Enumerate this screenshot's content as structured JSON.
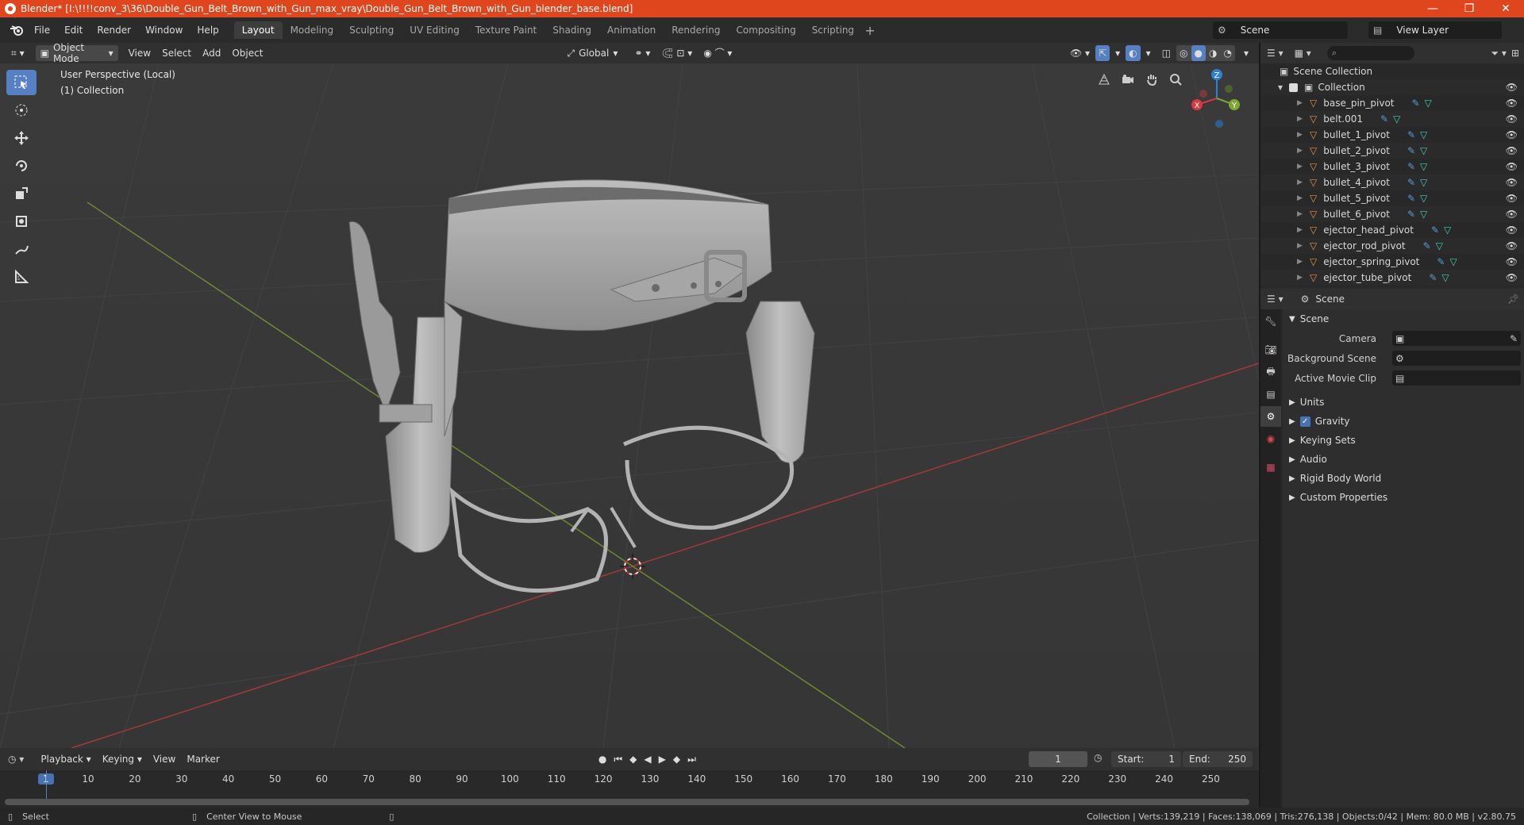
{
  "window": {
    "title": "Blender* [I:\\!!!!conv_3\\36\\Double_Gun_Belt_Brown_with_Gun_max_vray\\Double_Gun_Belt_Brown_with_Gun_blender_base.blend]",
    "minimize": "—",
    "maximize": "❐",
    "close": "✕"
  },
  "menu": [
    "File",
    "Edit",
    "Render",
    "Window",
    "Help"
  ],
  "workspaces": {
    "tabs": [
      "Layout",
      "Modeling",
      "Sculpting",
      "UV Editing",
      "Texture Paint",
      "Shading",
      "Animation",
      "Rendering",
      "Compositing",
      "Scripting"
    ],
    "active": "Layout",
    "add": "+"
  },
  "scene_selector": {
    "value": "Scene"
  },
  "view_layer_selector": {
    "value": "View Layer"
  },
  "viewport_header": {
    "mode": "Object Mode",
    "menus": [
      "View",
      "Select",
      "Add",
      "Object"
    ],
    "transform_orientation": "Global"
  },
  "viewport": {
    "info_line1": "User Perspective (Local)",
    "info_line2": "(1) Collection",
    "gizmo": {
      "x": "X",
      "y": "Y",
      "z": "Z"
    }
  },
  "outliner": {
    "root": "Scene Collection",
    "collection": "Collection",
    "items": [
      {
        "name": "base_pin_pivot"
      },
      {
        "name": "belt.001"
      },
      {
        "name": "bullet_1_pivot"
      },
      {
        "name": "bullet_2_pivot"
      },
      {
        "name": "bullet_3_pivot"
      },
      {
        "name": "bullet_4_pivot"
      },
      {
        "name": "bullet_5_pivot"
      },
      {
        "name": "bullet_6_pivot"
      },
      {
        "name": "ejector_head_pivot"
      },
      {
        "name": "ejector_rod_pivot"
      },
      {
        "name": "ejector_spring_pivot"
      },
      {
        "name": "ejector_tube_pivot"
      }
    ]
  },
  "properties": {
    "context": "Scene",
    "section": "Scene",
    "fields": [
      {
        "label": "Camera",
        "value": ""
      },
      {
        "label": "Background Scene",
        "value": ""
      },
      {
        "label": "Active Movie Clip",
        "value": ""
      }
    ],
    "panels": [
      "Units",
      "Gravity",
      "Keying Sets",
      "Audio",
      "Rigid Body World",
      "Custom Properties"
    ],
    "gravity_checked": true
  },
  "timeline": {
    "menus": [
      "Playback",
      "Keying",
      "View",
      "Marker"
    ],
    "current_frame": "1",
    "start_label": "Start:",
    "start": "1",
    "end_label": "End:",
    "end": "250",
    "ticks": [
      "1",
      "10",
      "20",
      "30",
      "40",
      "50",
      "60",
      "70",
      "80",
      "90",
      "100",
      "110",
      "120",
      "130",
      "140",
      "150",
      "160",
      "170",
      "180",
      "190",
      "200",
      "210",
      "220",
      "230",
      "240",
      "250"
    ]
  },
  "status": {
    "select": "Select",
    "center": "Center View to Mouse",
    "stats": "Collection | Verts:139,219 | Faces:138,069 | Tris:276,138 | Objects:0/42 | Mem: 80.0 MB | v2.80.75"
  },
  "colors": {
    "title_bar": "#e0461e",
    "accent": "#5680c2",
    "x_axis": "#d9383f",
    "y_axis": "#7fa731",
    "z_axis": "#2f80d8",
    "object_icon": "#e59545",
    "mesh_icon": "#3fd0b5",
    "modifier_icon": "#5a9bd8"
  }
}
